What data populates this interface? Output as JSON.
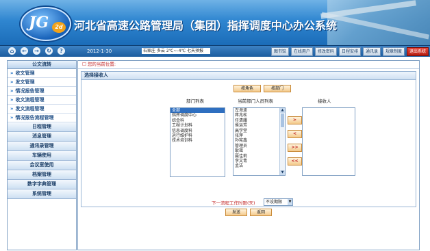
{
  "header": {
    "logo_text": "JG",
    "logo_sub": "2d",
    "title": "河北省高速公路管理局（集团）指挥调度中心办公系统"
  },
  "toolbar": {
    "nav_icons": [
      "home-icon",
      "back-icon",
      "forward-icon",
      "refresh-icon",
      "help-icon"
    ],
    "nav_glyphs": [
      "⌂",
      "←",
      "→",
      "↻",
      "?"
    ],
    "date": "2012-1-30",
    "weather": "石家庄  多云  2℃~-4℃  七天预报",
    "links": [
      "图书馆",
      "在线用户",
      "修改密码",
      "日程安排",
      "通讯录",
      "规章制度",
      "退出系统"
    ]
  },
  "sidebar": {
    "header": "公文流转",
    "items": [
      "收文管理",
      "发文管理",
      "情况报告管理",
      "收文流程管理",
      "发文流程管理",
      "情况报告流程管理"
    ],
    "categories": [
      "日程管理",
      "消息管理",
      "通讯录管理",
      "车辆使用",
      "会议室使用",
      "档案管理",
      "数字字典管理",
      "系统管理"
    ]
  },
  "main": {
    "location": "您的当前位置:",
    "panel_title": "选择接收人",
    "by_role_button": "按角色",
    "by_dept_button": "按部门",
    "dept_list_label": "部门列表",
    "person_list_label": "当前部门人员列表",
    "receiver_label": "接收人",
    "departments": [
      "全部",
      "指挥调度中心",
      "综合科",
      "工程计划科",
      "信息调度科",
      "运行维护科",
      "技术培训科"
    ],
    "persons": [
      "左海波",
      "蒋兆松",
      "任清耀",
      "侯运芳",
      "高学堂",
      "张萍",
      "孙宪鑫",
      "管理员",
      "耿瑶",
      "聂佳莉",
      "李文青",
      "孟洁"
    ],
    "receivers": [],
    "move_buttons": [
      ">",
      "<",
      ">>",
      "<<"
    ],
    "deadline_label": "下一流程工作时限(天)",
    "deadline_value": "不设期限",
    "send_button": "发送",
    "back_button": "返回"
  },
  "colors": {
    "banner": "#2f86d0",
    "accent_red": "#c02020",
    "exit": "#b51d12"
  }
}
